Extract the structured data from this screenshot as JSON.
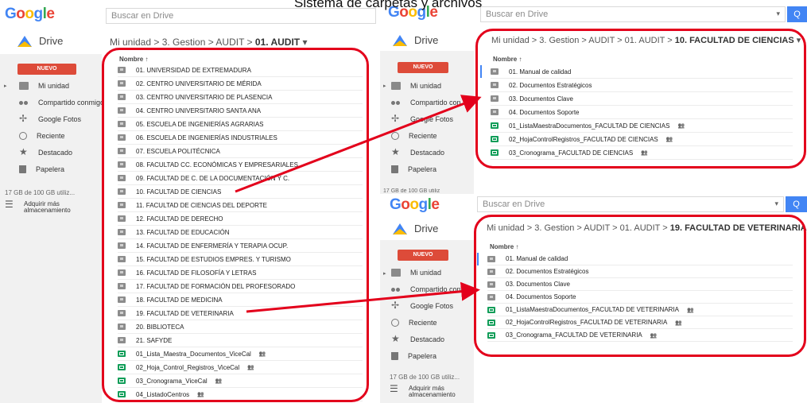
{
  "caption": "Sistema de carpetas y archivos",
  "brand": {
    "logo_letters": [
      "G",
      "o",
      "o",
      "g",
      "l",
      "e"
    ],
    "drive_label": "Drive"
  },
  "search_placeholder": "Buscar en Drive",
  "search_button": "Q",
  "sidebar": {
    "new_button": "NUEVO",
    "items": [
      "Mi unidad",
      "Compartido conmigo",
      "Google Fotos",
      "Reciente",
      "Destacado",
      "Papelera"
    ],
    "items_truncated": [
      "Mi unidad",
      "Compartido con",
      "Google Fotos",
      "Reciente",
      "Destacado",
      "Papelera"
    ],
    "storage": "17 GB de 100 GB utiliz...",
    "storage_cut": "17 GB de 100 GB utiliz",
    "buy_storage_1": "Adquirir más",
    "buy_storage_2": "almacenamiento"
  },
  "left_panel": {
    "breadcrumb": {
      "path": "Mi unidad  >  3. Gestion  >  AUDIT  >  ",
      "current": "01. AUDIT",
      "dropdown": "▾"
    },
    "column_header": "Nombre  ↑",
    "rows": [
      {
        "name": "01. UNIVERSIDAD DE EXTREMADURA",
        "type": "folder"
      },
      {
        "name": "02. CENTRO UNIVERSITARIO DE MÉRIDA",
        "type": "folder"
      },
      {
        "name": "03. CENTRO UNIVERSITARIO DE PLASENCIA",
        "type": "folder"
      },
      {
        "name": "04. CENTRO UNIVERSITARIO SANTA ANA",
        "type": "folder"
      },
      {
        "name": "05. ESCUELA DE INGENIERÍAS AGRARIAS",
        "type": "folder"
      },
      {
        "name": "06. ESCUELA DE INGENIERÍAS INDUSTRIALES",
        "type": "folder"
      },
      {
        "name": "07. ESCUELA POLITÉCNICA",
        "type": "folder"
      },
      {
        "name": "08. FACULTAD CC. ECONÓMICAS Y EMPRESARIALES",
        "type": "folder"
      },
      {
        "name": "09. FACULTAD DE C. DE LA DOCUMENTACIÓN Y C.",
        "type": "folder"
      },
      {
        "name": "10. FACULTAD DE CIENCIAS",
        "type": "folder"
      },
      {
        "name": "11. FACULTAD DE CIENCIAS DEL DEPORTE",
        "type": "folder"
      },
      {
        "name": "12. FACULTAD DE DERECHO",
        "type": "folder"
      },
      {
        "name": "13. FACULTAD DE EDUCACIÓN",
        "type": "folder"
      },
      {
        "name": "14. FACULTAD DE ENFERMERÍA Y TERAPIA OCUP.",
        "type": "folder"
      },
      {
        "name": "15. FACULTAD DE ESTUDIOS EMPRES. Y TURISMO",
        "type": "folder"
      },
      {
        "name": "16. FACULTAD DE FILOSOFÍA Y LETRAS",
        "type": "folder"
      },
      {
        "name": "17. FACULTAD DE FORMACIÓN DEL PROFESORADO",
        "type": "folder"
      },
      {
        "name": "18. FACULTAD DE MEDICINA",
        "type": "folder"
      },
      {
        "name": "19. FACULTAD DE VETERINARIA",
        "type": "folder"
      },
      {
        "name": "20. BIBLIOTECA",
        "type": "folder"
      },
      {
        "name": "21. SAFYDE",
        "type": "folder"
      },
      {
        "name": "01_Lista_Maestra_Documentos_ViceCal",
        "type": "sheet",
        "shared": true
      },
      {
        "name": "02_Hoja_Control_Registros_ViceCal",
        "type": "sheet",
        "shared": true
      },
      {
        "name": "03_Cronograma_ViceCal",
        "type": "sheet",
        "shared": true
      },
      {
        "name": "04_ListadoCentros",
        "type": "sheet",
        "shared": true
      }
    ]
  },
  "top_right_panel": {
    "breadcrumb": {
      "path": "Mi unidad  >  3. Gestion  >  AUDIT  >  01. AUDIT  >  ",
      "current": "10. FACULTAD DE CIENCIAS",
      "dropdown": "▾"
    },
    "column_header": "Nombre  ↑",
    "rows": [
      {
        "name": "01. Manual de calidad",
        "type": "folder"
      },
      {
        "name": "02. Documentos Estratégicos",
        "type": "folder"
      },
      {
        "name": "03. Documentos Clave",
        "type": "folder"
      },
      {
        "name": "04. Documentos Soporte",
        "type": "folder"
      },
      {
        "name": "01_ListaMaestraDocumentos_FACULTAD DE CIENCIAS",
        "type": "sheet",
        "shared": true
      },
      {
        "name": "02_HojaControlRegistros_FACULTAD DE CIENCIAS",
        "type": "sheet",
        "shared": true
      },
      {
        "name": "03_Cronograma_FACULTAD DE CIENCIAS",
        "type": "sheet",
        "shared": true
      }
    ]
  },
  "bottom_right_panel": {
    "breadcrumb": {
      "path": "Mi unidad  >  3. Gestion  >  AUDIT  >  01. AUDIT  >  ",
      "current": "19. FACULTAD DE VETERINARIA",
      "dropdown": "▾"
    },
    "column_header": "Nombre  ↑",
    "rows": [
      {
        "name": "01. Manual de calidad",
        "type": "folder"
      },
      {
        "name": "02. Documentos Estratégicos",
        "type": "folder"
      },
      {
        "name": "03. Documentos Clave",
        "type": "folder"
      },
      {
        "name": "04. Documentos Soporte",
        "type": "folder"
      },
      {
        "name": "01_ListaMaestraDocumentos_FACULTAD DE VETERINARIA",
        "type": "sheet",
        "shared": true
      },
      {
        "name": "02_HojaControlRegistros_FACULTAD DE VETERINARIA",
        "type": "sheet",
        "shared": true
      },
      {
        "name": "03_Cronograma_FACULTAD DE VETERINARIA",
        "type": "sheet",
        "shared": true
      }
    ]
  },
  "colors": {
    "accent_blue": "#4285f4",
    "new_red": "#dd4b39",
    "highlight_red": "#e3001b",
    "sheet_green": "#0f9d58"
  },
  "icons": [
    "drive-logo-icon",
    "folder-icon",
    "people-icon",
    "photos-icon",
    "clock-icon",
    "star-icon",
    "trash-icon",
    "storage-icon",
    "sheet-icon",
    "sort-up-icon",
    "shared-icon",
    "dropdown-icon"
  ]
}
